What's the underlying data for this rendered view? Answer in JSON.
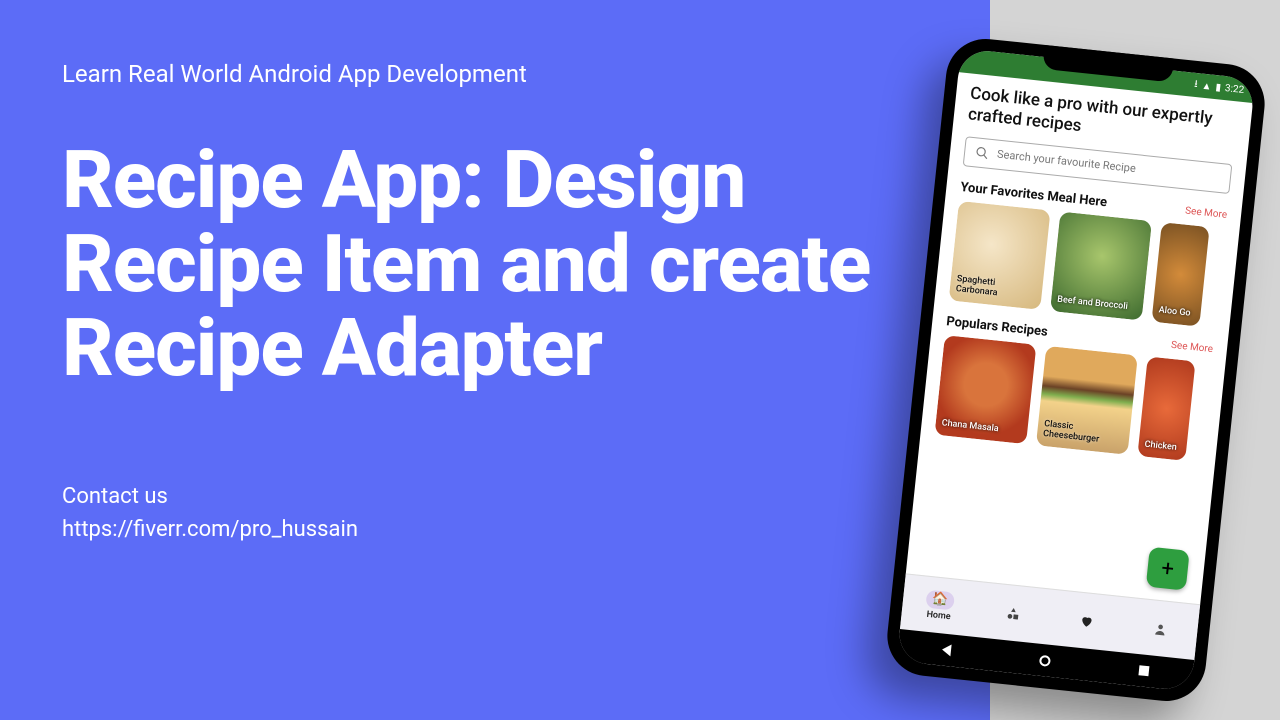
{
  "left": {
    "subtitle": "Learn Real World Android App Development",
    "title": "Recipe App: Design Recipe Item and create Recipe Adapter",
    "contact_label": "Contact us",
    "contact_url": "https://fiverr.com/pro_hussain"
  },
  "phone": {
    "headline": "Cook like a pro with our expertly crafted recipes",
    "search_placeholder": "Search your favourite Recipe",
    "favorites": {
      "title": "Your Favorites Meal Here",
      "see_more": "See More",
      "items": [
        {
          "name": "Spaghetti Carbonara"
        },
        {
          "name": "Beef and Broccoli"
        },
        {
          "name": "Aloo Go"
        }
      ]
    },
    "popular": {
      "title": "Populars Recipes",
      "see_more": "See More",
      "items": [
        {
          "name": "Chana Masala"
        },
        {
          "name": "Classic Cheeseburger"
        },
        {
          "name": "Chicken"
        }
      ]
    },
    "fab": "+",
    "nav": {
      "home": "Home"
    }
  }
}
